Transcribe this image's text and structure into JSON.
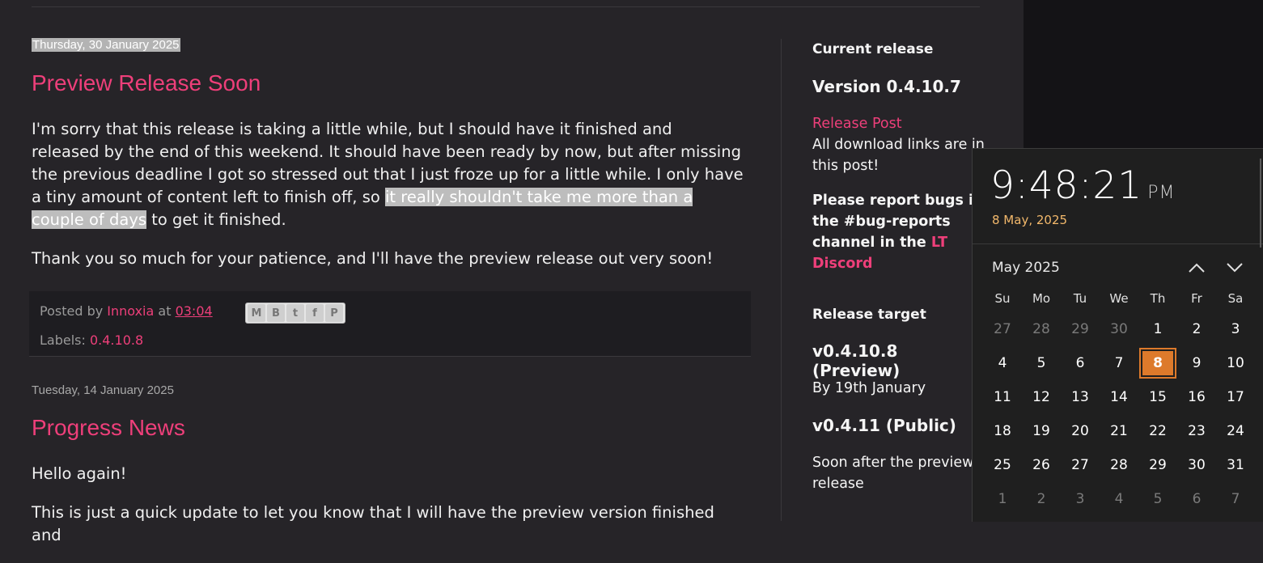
{
  "posts": [
    {
      "date": "Thursday, 30 January 2025",
      "title": "Preview Release Soon",
      "p1_a": "I'm sorry that this release is taking a little while, but I should have it finished and released by the end of this weekend. It should have been ready by now, but after missing the previous deadline I got so stressed out that I just froze up for a little while. I only have a tiny amount of content left to finish off, so ",
      "p1_highlight": "it really shouldn't take me more than a couple of days",
      "p1_b": " to get it finished.",
      "p2": "Thank you so much for your patience, and I'll have the preview release out very soon!",
      "posted_by_label": "Posted by",
      "author": "Innoxia",
      "at_label": "at",
      "time": "03:04",
      "labels_label": "Labels:",
      "label": "0.4.10.8"
    },
    {
      "date": "Tuesday, 14 January 2025",
      "title": "Progress News",
      "p1": "Hello again!",
      "p2": "This is just a quick update to let you know that I will have the preview version finished and"
    }
  ],
  "share_icons": [
    "email-icon",
    "blogger-icon",
    "twitter-icon",
    "facebook-icon",
    "pinterest-icon"
  ],
  "sidebar": {
    "current_release_heading": "Current release",
    "current_version": "Version 0.4.10.7",
    "release_post_link": "Release Post",
    "release_post_note": "All download links are in this post!",
    "bug_text": "Please report bugs in the #bug-reports channel in the",
    "bug_link": "LT Discord",
    "release_target_heading": "Release target",
    "target1_version": "v0.4.10.8 (Preview)",
    "target1_date": "By 19th January",
    "target2_version": "v0.4.11 (Public)",
    "target2_date": "Soon after the preview release"
  },
  "clock": {
    "time": "9:48:21",
    "ampm": "PM",
    "long_date": "8 May, 2025",
    "month_label": "May 2025",
    "weekdays": [
      "Su",
      "Mo",
      "Tu",
      "We",
      "Th",
      "Fr",
      "Sa"
    ],
    "weeks": [
      [
        "27",
        "28",
        "29",
        "30",
        "1",
        "2",
        "3"
      ],
      [
        "4",
        "5",
        "6",
        "7",
        "8",
        "9",
        "10"
      ],
      [
        "11",
        "12",
        "13",
        "14",
        "15",
        "16",
        "17"
      ],
      [
        "18",
        "19",
        "20",
        "21",
        "22",
        "23",
        "24"
      ],
      [
        "25",
        "26",
        "27",
        "28",
        "29",
        "30",
        "31"
      ],
      [
        "1",
        "2",
        "3",
        "4",
        "5",
        "6",
        "7"
      ]
    ],
    "dim_prefix_first_week": 4,
    "today": "8",
    "accent_color": "#dd7a2b"
  },
  "colors": {
    "link": "#ee3f7a",
    "background": "#262428"
  }
}
